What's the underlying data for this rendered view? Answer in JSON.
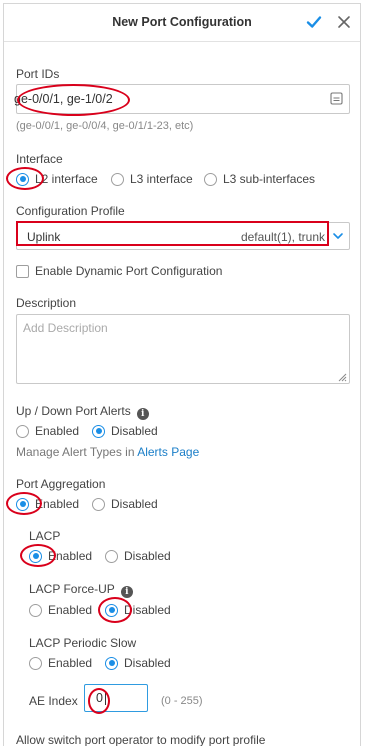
{
  "header": {
    "title": "New Port Configuration",
    "accent_color": "#1a8ee6"
  },
  "port_ids": {
    "label": "Port IDs",
    "value": "ge-0/0/1, ge-1/0/2",
    "hint": "(ge-0/0/1, ge-0/0/4, ge-0/1/1-23, etc)"
  },
  "interface": {
    "label": "Interface",
    "options": [
      "L2 interface",
      "L3 interface",
      "L3 sub-interfaces"
    ],
    "selected": "L2 interface"
  },
  "config_profile": {
    "label": "Configuration Profile",
    "value": "Uplink",
    "detail": "default(1), trunk"
  },
  "dynamic_port": {
    "label": "Enable Dynamic Port Configuration",
    "checked": false
  },
  "description": {
    "label": "Description",
    "placeholder": "Add Description"
  },
  "port_alerts": {
    "label": "Up / Down Port Alerts",
    "options": [
      "Enabled",
      "Disabled"
    ],
    "selected": "Disabled",
    "manage_text": "Manage Alert Types in",
    "manage_link": "Alerts Page"
  },
  "port_aggregation": {
    "label": "Port Aggregation",
    "options": [
      "Enabled",
      "Disabled"
    ],
    "selected": "Enabled"
  },
  "lacp": {
    "label": "LACP",
    "options": [
      "Enabled",
      "Disabled"
    ],
    "selected": "Enabled"
  },
  "lacp_force_up": {
    "label": "LACP Force-UP",
    "options": [
      "Enabled",
      "Disabled"
    ],
    "selected": "Disabled"
  },
  "lacp_periodic_slow": {
    "label": "LACP Periodic Slow",
    "options": [
      "Enabled",
      "Disabled"
    ],
    "selected": "Disabled"
  },
  "ae_index": {
    "label": "AE Index",
    "value": "0",
    "range": "(0 - 255)"
  },
  "footer_text": "Allow switch port operator to modify port profile",
  "annotation_color": "#d9001b"
}
